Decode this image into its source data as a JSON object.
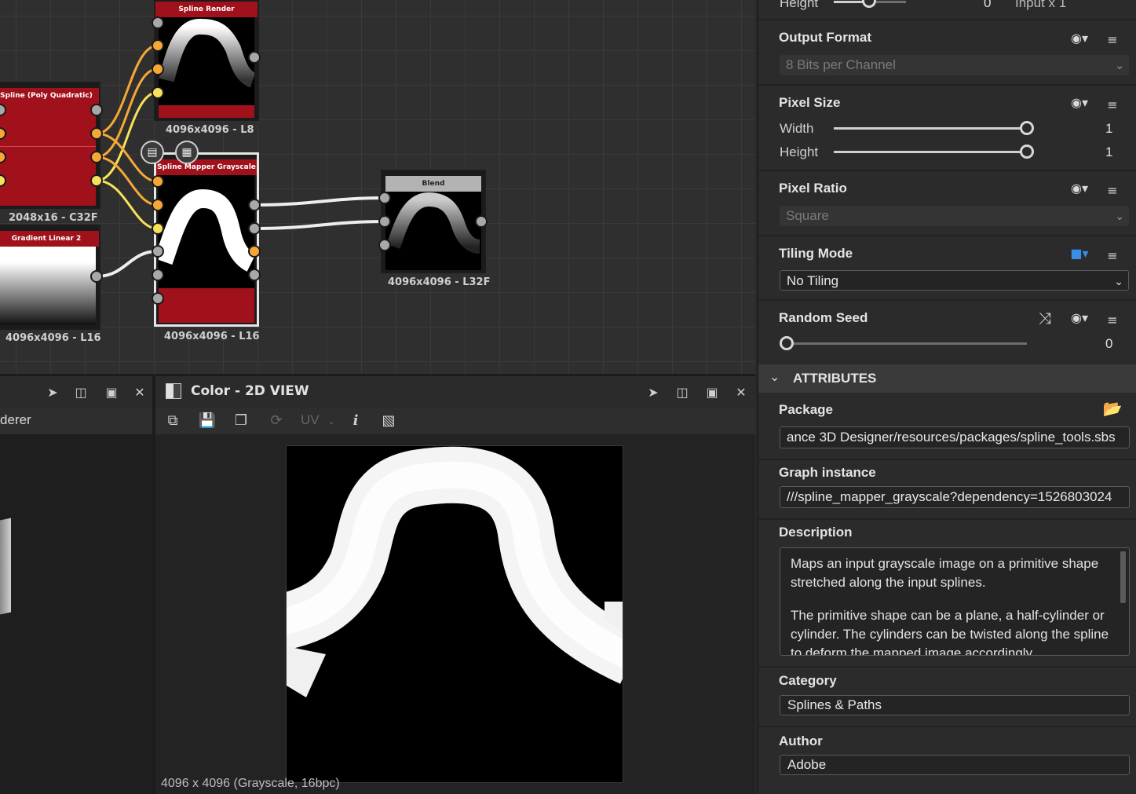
{
  "graph": {
    "nodes": {
      "spline_render": {
        "title": "Spline Render",
        "label": "4096x4096 - L8"
      },
      "spline_poly": {
        "title": "Spline (Poly Quadratic)",
        "label": "2048x16 - C32F"
      },
      "spline_mapper": {
        "title": "Spline Mapper Grayscale",
        "label": "4096x4096 - L16"
      },
      "gradient": {
        "title": "Gradient Linear 2",
        "label": "4096x4096 - L16"
      },
      "blend": {
        "title": "Blend",
        "label": "4096x4096 - L32F"
      }
    },
    "colors": {
      "red_header": "#a0111b",
      "grey_header": "#b3b3b3",
      "orange": "#f6a836",
      "yellow": "#f7e05a"
    }
  },
  "left_panel": {
    "partial_label": "derer"
  },
  "view2d": {
    "title": "Color - 2D VIEW",
    "uv_label": "UV",
    "status": "4096 x 4096 (Grayscale, 16bpc)"
  },
  "props": {
    "top_partial": {
      "label": "Height",
      "value": "0",
      "input_label": "Input x 1"
    },
    "output_format": {
      "title": "Output Format",
      "value": "8 Bits per Channel"
    },
    "pixel_size": {
      "title": "Pixel Size",
      "width_label": "Width",
      "width_value": "1",
      "width_level": 1.0,
      "height_label": "Height",
      "height_value": "1",
      "height_level": 1.0
    },
    "pixel_ratio": {
      "title": "Pixel Ratio",
      "value": "Square"
    },
    "tiling_mode": {
      "title": "Tiling Mode",
      "value": "No Tiling"
    },
    "random_seed": {
      "title": "Random Seed",
      "value": "0",
      "level": 0.0
    },
    "attributes_header": "ATTRIBUTES",
    "package": {
      "title": "Package",
      "value": "ance 3D Designer/resources/packages/spline_tools.sbs"
    },
    "graph_instance": {
      "title": "Graph instance",
      "value": "///spline_mapper_grayscale?dependency=1526803024"
    },
    "description": {
      "title": "Description",
      "p1": "Maps an input grayscale image on a primitive shape stretched along the input splines.",
      "p2": "The primitive shape can be a plane, a half-cylinder or cylinder. The cylinders can be twisted along the spline to deform the mapped image accordingly."
    },
    "category": {
      "title": "Category",
      "value": "Splines & Paths"
    },
    "author": {
      "title": "Author",
      "value": "Adobe"
    }
  }
}
